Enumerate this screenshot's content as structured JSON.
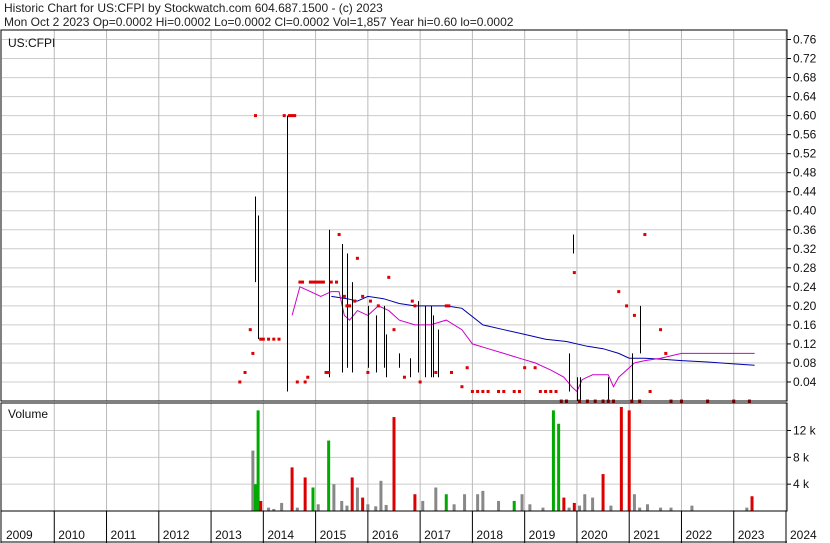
{
  "header": {
    "line1": "Historic Chart for US:CFPI by Stockwatch.com 604.687.1500 - (c) 2023",
    "line2": "Mon Oct  2 2023  Op=0.0002  Hi=0.0002  Lo=0.0002  Cl=0.0002  Vol=1,857  Year hi=0.60  lo=0.0002"
  },
  "colors": {
    "price_bar": "#000000",
    "price_dot": "#dd0000",
    "ma_long": "#0000aa",
    "ma_short": "#cc00cc",
    "vol_up": "#00aa00",
    "vol_down": "#dd0000",
    "vol_flat": "#888888",
    "grid": "#cccccc"
  },
  "chart_data": [
    {
      "type": "line",
      "title": "US:CFPI",
      "y_ticks": [
        "0.76",
        "0.72",
        "0.68",
        "0.64",
        "0.60",
        "0.56",
        "0.52",
        "0.48",
        "0.44",
        "0.40",
        "0.36",
        "0.32",
        "0.28",
        "0.24",
        "0.20",
        "0.16",
        "0.12",
        "0.08",
        "0.04"
      ],
      "ylim": [
        0,
        0.78
      ],
      "xlim": [
        2009.0,
        2024.0
      ],
      "grid": true,
      "series": [
        {
          "style": "line-blue",
          "x": [
            2015.3,
            2015.6,
            2015.8,
            2016.0,
            2016.3,
            2016.6,
            2016.9,
            2017.2,
            2017.5,
            2017.8,
            2018.2,
            2018.6,
            2019.0,
            2019.4,
            2019.8,
            2020.2,
            2020.5,
            2020.8,
            2021.0,
            2021.3,
            2021.6,
            2022.0,
            2022.5,
            2023.0,
            2023.4
          ],
          "y": [
            0.22,
            0.215,
            0.21,
            0.22,
            0.215,
            0.205,
            0.2,
            0.2,
            0.2,
            0.195,
            0.16,
            0.15,
            0.14,
            0.13,
            0.125,
            0.115,
            0.11,
            0.1,
            0.09,
            0.09,
            0.088,
            0.085,
            0.082,
            0.078,
            0.075
          ]
        },
        {
          "style": "line-magenta",
          "x": [
            2014.55,
            2014.7,
            2014.9,
            2015.1,
            2015.3,
            2015.45,
            2015.55,
            2015.65,
            2015.8,
            2016.0,
            2016.2,
            2016.4,
            2016.6,
            2016.9,
            2017.2,
            2017.5,
            2017.8,
            2018.0,
            2018.3,
            2018.6,
            2018.9,
            2019.2,
            2019.5,
            2019.75,
            2019.9,
            2020.0,
            2020.1,
            2020.3,
            2020.6,
            2020.7,
            2020.8,
            2021.0,
            2021.1,
            2021.3,
            2021.6,
            2022.0,
            2022.5,
            2023.0,
            2023.4
          ],
          "y": [
            0.18,
            0.24,
            0.23,
            0.22,
            0.23,
            0.23,
            0.18,
            0.17,
            0.19,
            0.18,
            0.2,
            0.19,
            0.17,
            0.16,
            0.16,
            0.17,
            0.15,
            0.12,
            0.11,
            0.1,
            0.09,
            0.08,
            0.065,
            0.05,
            0.03,
            0.02,
            0.045,
            0.055,
            0.055,
            0.03,
            0.05,
            0.07,
            0.08,
            0.085,
            0.09,
            0.1,
            0.1,
            0.1,
            0.1
          ]
        },
        {
          "style": "hl-bars",
          "x": [
            2013.85,
            2013.9,
            2014.45,
            2015.25,
            2015.5,
            2015.6,
            2015.7,
            2016.0,
            2016.15,
            2016.3,
            2016.35,
            2016.6,
            2016.8,
            2016.95,
            2017.1,
            2017.2,
            2017.25,
            2017.35,
            2019.85,
            2019.92,
            2020.0,
            2020.05,
            2020.6,
            2021.05,
            2021.2
          ],
          "high": [
            0.43,
            0.39,
            0.6,
            0.36,
            0.33,
            0.31,
            0.25,
            0.2,
            0.18,
            0.2,
            0.14,
            0.1,
            0.09,
            0.21,
            0.2,
            0.2,
            0.18,
            0.15,
            0.1,
            0.35,
            0.05,
            0.05,
            0.05,
            0.1,
            0.2
          ],
          "low": [
            0.25,
            0.13,
            0.02,
            0.05,
            0.06,
            0.07,
            0.06,
            0.07,
            0.06,
            0.07,
            0.05,
            0.07,
            0.05,
            0.06,
            0.05,
            0.05,
            0.05,
            0.05,
            0.02,
            0.31,
            0.0,
            0.0,
            0.0,
            0.0,
            0.1
          ]
        },
        {
          "style": "dots",
          "x": [
            2013.55,
            2013.65,
            2013.75,
            2013.8,
            2013.85,
            2013.95,
            2014.0,
            2014.1,
            2014.2,
            2014.3,
            2014.4,
            2014.5,
            2014.55,
            2014.6,
            2014.65,
            2014.7,
            2014.75,
            2014.8,
            2014.85,
            2014.9,
            2014.95,
            2015.0,
            2015.05,
            2015.1,
            2015.15,
            2015.2,
            2015.25,
            2015.3,
            2015.4,
            2015.45,
            2015.55,
            2015.6,
            2015.65,
            2015.75,
            2015.8,
            2015.9,
            2016.0,
            2016.05,
            2016.2,
            2016.4,
            2016.5,
            2016.7,
            2016.85,
            2016.9,
            2017.0,
            2017.3,
            2017.5,
            2017.55,
            2017.6,
            2017.8,
            2017.9,
            2018.0,
            2018.1,
            2018.2,
            2018.3,
            2018.5,
            2018.6,
            2018.8,
            2018.9,
            2019.0,
            2019.2,
            2019.3,
            2019.4,
            2019.5,
            2019.6,
            2019.7,
            2019.8,
            2019.95,
            2020.05,
            2020.2,
            2020.35,
            2020.5,
            2020.6,
            2020.7,
            2020.8,
            2020.95,
            2021.05,
            2021.1,
            2021.2,
            2021.3,
            2021.4,
            2021.6,
            2021.7,
            2021.8,
            2022.0,
            2022.5,
            2023.0,
            2023.3
          ],
          "y": [
            0.04,
            0.06,
            0.15,
            0.1,
            0.6,
            0.13,
            0.13,
            0.13,
            0.13,
            0.13,
            0.6,
            0.6,
            0.6,
            0.6,
            0.04,
            0.25,
            0.25,
            0.04,
            0.05,
            0.25,
            0.25,
            0.25,
            0.25,
            0.25,
            0.25,
            0.06,
            0.06,
            0.25,
            0.25,
            0.35,
            0.22,
            0.2,
            0.2,
            0.21,
            0.3,
            0.22,
            0.06,
            0.21,
            0.2,
            0.26,
            0.15,
            0.05,
            0.21,
            0.2,
            0.04,
            0.06,
            0.2,
            0.2,
            0.06,
            0.03,
            0.07,
            0.02,
            0.02,
            0.02,
            0.02,
            0.02,
            0.02,
            0.02,
            0.02,
            0.07,
            0.07,
            0.02,
            0.02,
            0.02,
            0.02,
            0.0,
            0.0,
            0.27,
            0.0,
            0.0,
            0.0,
            0.0,
            0.0,
            0.0,
            0.23,
            0.2,
            0.0,
            0.18,
            0.0,
            0.35,
            0.02,
            0.15,
            0.1,
            0.0,
            0.0,
            0.0,
            0.0,
            0.0
          ]
        }
      ]
    },
    {
      "type": "bar",
      "title": "Volume",
      "y_ticks": [
        "12 k",
        "8 k",
        "4 k"
      ],
      "ylim": [
        0,
        15500
      ],
      "x_ticks": [
        "2009",
        "2010",
        "2011",
        "2012",
        "2013",
        "2014",
        "2015",
        "2016",
        "2017",
        "2018",
        "2019",
        "2020",
        "2021",
        "2022",
        "2023",
        "2024"
      ],
      "xlim": [
        2009.0,
        2024.0
      ],
      "grid": true,
      "bars": {
        "x": [
          2013.8,
          2013.85,
          2013.9,
          2013.95,
          2014.1,
          2014.2,
          2014.35,
          2014.55,
          2014.65,
          2014.8,
          2014.95,
          2015.05,
          2015.25,
          2015.35,
          2015.5,
          2015.6,
          2015.7,
          2015.8,
          2015.9,
          2016.0,
          2016.15,
          2016.25,
          2016.35,
          2016.5,
          2016.9,
          2017.05,
          2017.3,
          2017.5,
          2017.65,
          2017.85,
          2018.1,
          2018.2,
          2018.5,
          2018.8,
          2018.95,
          2019.1,
          2019.35,
          2019.55,
          2019.65,
          2019.75,
          2019.85,
          2019.95,
          2020.05,
          2020.15,
          2020.3,
          2020.5,
          2020.65,
          2020.85,
          2021.0,
          2021.1,
          2021.2,
          2021.35,
          2021.6,
          2021.8,
          2022.2,
          2023.25,
          2023.35
        ],
        "values": [
          9000,
          4000,
          15000,
          1500,
          500,
          300,
          1200,
          6500,
          500,
          5000,
          3500,
          1000,
          10500,
          4000,
          1500,
          800,
          5000,
          3500,
          2000,
          1000,
          700,
          4500,
          900,
          14000,
          2500,
          1500,
          3500,
          2500,
          1000,
          2500,
          2500,
          3000,
          1500,
          1500,
          2500,
          1000,
          500,
          15000,
          13000,
          2000,
          500,
          1200,
          800,
          2500,
          2000,
          5500,
          800,
          15500,
          15000,
          2500,
          500,
          1000,
          500,
          500,
          800,
          500,
          2200
        ],
        "colors": [
          "flat",
          "up",
          "up",
          "down",
          "flat",
          "flat",
          "flat",
          "down",
          "flat",
          "down",
          "up",
          "flat",
          "up",
          "flat",
          "flat",
          "flat",
          "down",
          "flat",
          "down",
          "flat",
          "flat",
          "flat",
          "flat",
          "down",
          "down",
          "flat",
          "flat",
          "up",
          "flat",
          "flat",
          "flat",
          "flat",
          "flat",
          "up",
          "flat",
          "flat",
          "flat",
          "up",
          "up",
          "down",
          "flat",
          "down",
          "flat",
          "flat",
          "flat",
          "down",
          "flat",
          "down",
          "down",
          "flat",
          "flat",
          "flat",
          "flat",
          "flat",
          "flat",
          "flat",
          "down"
        ]
      }
    }
  ]
}
